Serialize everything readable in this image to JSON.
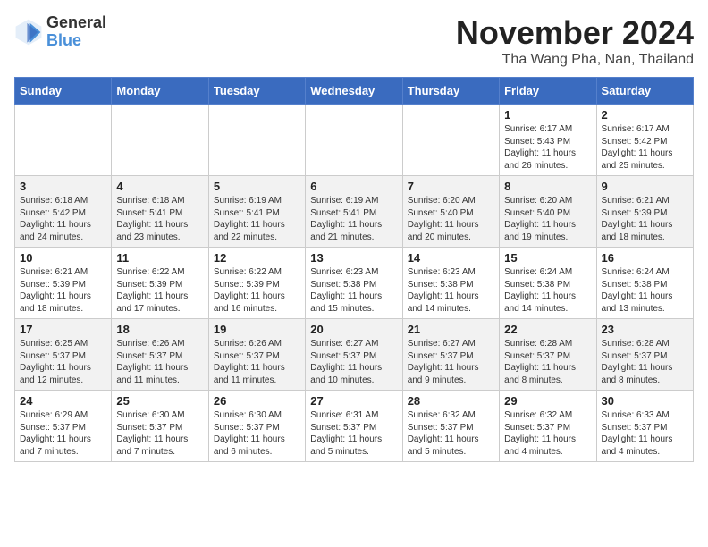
{
  "header": {
    "logo_general": "General",
    "logo_blue": "Blue",
    "month_title": "November 2024",
    "location": "Tha Wang Pha, Nan, Thailand"
  },
  "days_of_week": [
    "Sunday",
    "Monday",
    "Tuesday",
    "Wednesday",
    "Thursday",
    "Friday",
    "Saturday"
  ],
  "weeks": [
    [
      {
        "day": "",
        "info": ""
      },
      {
        "day": "",
        "info": ""
      },
      {
        "day": "",
        "info": ""
      },
      {
        "day": "",
        "info": ""
      },
      {
        "day": "",
        "info": ""
      },
      {
        "day": "1",
        "info": "Sunrise: 6:17 AM\nSunset: 5:43 PM\nDaylight: 11 hours and 26 minutes."
      },
      {
        "day": "2",
        "info": "Sunrise: 6:17 AM\nSunset: 5:42 PM\nDaylight: 11 hours and 25 minutes."
      }
    ],
    [
      {
        "day": "3",
        "info": "Sunrise: 6:18 AM\nSunset: 5:42 PM\nDaylight: 11 hours and 24 minutes."
      },
      {
        "day": "4",
        "info": "Sunrise: 6:18 AM\nSunset: 5:41 PM\nDaylight: 11 hours and 23 minutes."
      },
      {
        "day": "5",
        "info": "Sunrise: 6:19 AM\nSunset: 5:41 PM\nDaylight: 11 hours and 22 minutes."
      },
      {
        "day": "6",
        "info": "Sunrise: 6:19 AM\nSunset: 5:41 PM\nDaylight: 11 hours and 21 minutes."
      },
      {
        "day": "7",
        "info": "Sunrise: 6:20 AM\nSunset: 5:40 PM\nDaylight: 11 hours and 20 minutes."
      },
      {
        "day": "8",
        "info": "Sunrise: 6:20 AM\nSunset: 5:40 PM\nDaylight: 11 hours and 19 minutes."
      },
      {
        "day": "9",
        "info": "Sunrise: 6:21 AM\nSunset: 5:39 PM\nDaylight: 11 hours and 18 minutes."
      }
    ],
    [
      {
        "day": "10",
        "info": "Sunrise: 6:21 AM\nSunset: 5:39 PM\nDaylight: 11 hours and 18 minutes."
      },
      {
        "day": "11",
        "info": "Sunrise: 6:22 AM\nSunset: 5:39 PM\nDaylight: 11 hours and 17 minutes."
      },
      {
        "day": "12",
        "info": "Sunrise: 6:22 AM\nSunset: 5:39 PM\nDaylight: 11 hours and 16 minutes."
      },
      {
        "day": "13",
        "info": "Sunrise: 6:23 AM\nSunset: 5:38 PM\nDaylight: 11 hours and 15 minutes."
      },
      {
        "day": "14",
        "info": "Sunrise: 6:23 AM\nSunset: 5:38 PM\nDaylight: 11 hours and 14 minutes."
      },
      {
        "day": "15",
        "info": "Sunrise: 6:24 AM\nSunset: 5:38 PM\nDaylight: 11 hours and 14 minutes."
      },
      {
        "day": "16",
        "info": "Sunrise: 6:24 AM\nSunset: 5:38 PM\nDaylight: 11 hours and 13 minutes."
      }
    ],
    [
      {
        "day": "17",
        "info": "Sunrise: 6:25 AM\nSunset: 5:37 PM\nDaylight: 11 hours and 12 minutes."
      },
      {
        "day": "18",
        "info": "Sunrise: 6:26 AM\nSunset: 5:37 PM\nDaylight: 11 hours and 11 minutes."
      },
      {
        "day": "19",
        "info": "Sunrise: 6:26 AM\nSunset: 5:37 PM\nDaylight: 11 hours and 11 minutes."
      },
      {
        "day": "20",
        "info": "Sunrise: 6:27 AM\nSunset: 5:37 PM\nDaylight: 11 hours and 10 minutes."
      },
      {
        "day": "21",
        "info": "Sunrise: 6:27 AM\nSunset: 5:37 PM\nDaylight: 11 hours and 9 minutes."
      },
      {
        "day": "22",
        "info": "Sunrise: 6:28 AM\nSunset: 5:37 PM\nDaylight: 11 hours and 8 minutes."
      },
      {
        "day": "23",
        "info": "Sunrise: 6:28 AM\nSunset: 5:37 PM\nDaylight: 11 hours and 8 minutes."
      }
    ],
    [
      {
        "day": "24",
        "info": "Sunrise: 6:29 AM\nSunset: 5:37 PM\nDaylight: 11 hours and 7 minutes."
      },
      {
        "day": "25",
        "info": "Sunrise: 6:30 AM\nSunset: 5:37 PM\nDaylight: 11 hours and 7 minutes."
      },
      {
        "day": "26",
        "info": "Sunrise: 6:30 AM\nSunset: 5:37 PM\nDaylight: 11 hours and 6 minutes."
      },
      {
        "day": "27",
        "info": "Sunrise: 6:31 AM\nSunset: 5:37 PM\nDaylight: 11 hours and 5 minutes."
      },
      {
        "day": "28",
        "info": "Sunrise: 6:32 AM\nSunset: 5:37 PM\nDaylight: 11 hours and 5 minutes."
      },
      {
        "day": "29",
        "info": "Sunrise: 6:32 AM\nSunset: 5:37 PM\nDaylight: 11 hours and 4 minutes."
      },
      {
        "day": "30",
        "info": "Sunrise: 6:33 AM\nSunset: 5:37 PM\nDaylight: 11 hours and 4 minutes."
      }
    ]
  ]
}
